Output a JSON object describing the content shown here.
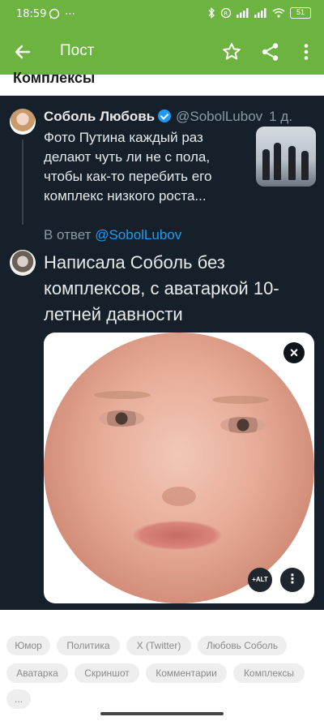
{
  "status_bar": {
    "time": "18:59",
    "battery": "51"
  },
  "app_bar": {
    "title": "Пост"
  },
  "post": {
    "title": "Комплексы"
  },
  "tweet": {
    "author_name": "Соболь Любовь",
    "author_handle": "@SobolLubov",
    "time": "1 д.",
    "text": "Фото Путина каждый раз делают чуть ли не с пола, чтобы как-то перебить его комплекс низкого роста...",
    "reply_prefix": "В ответ",
    "reply_handle": "@SobolLubov",
    "reply_text": "Написала Соболь без комплексов, с аватаркой 10-летней давности",
    "media_alt_label": "+ALT"
  },
  "tags": [
    "Юмор",
    "Политика",
    "X (Twitter)",
    "Любовь Соболь",
    "Аватарка",
    "Скриншот",
    "Комментарии",
    "Комплексы",
    "..."
  ],
  "colors": {
    "app_green": "#6db33f",
    "tweet_bg": "#15202b",
    "twitter_blue": "#1d9bf0"
  }
}
